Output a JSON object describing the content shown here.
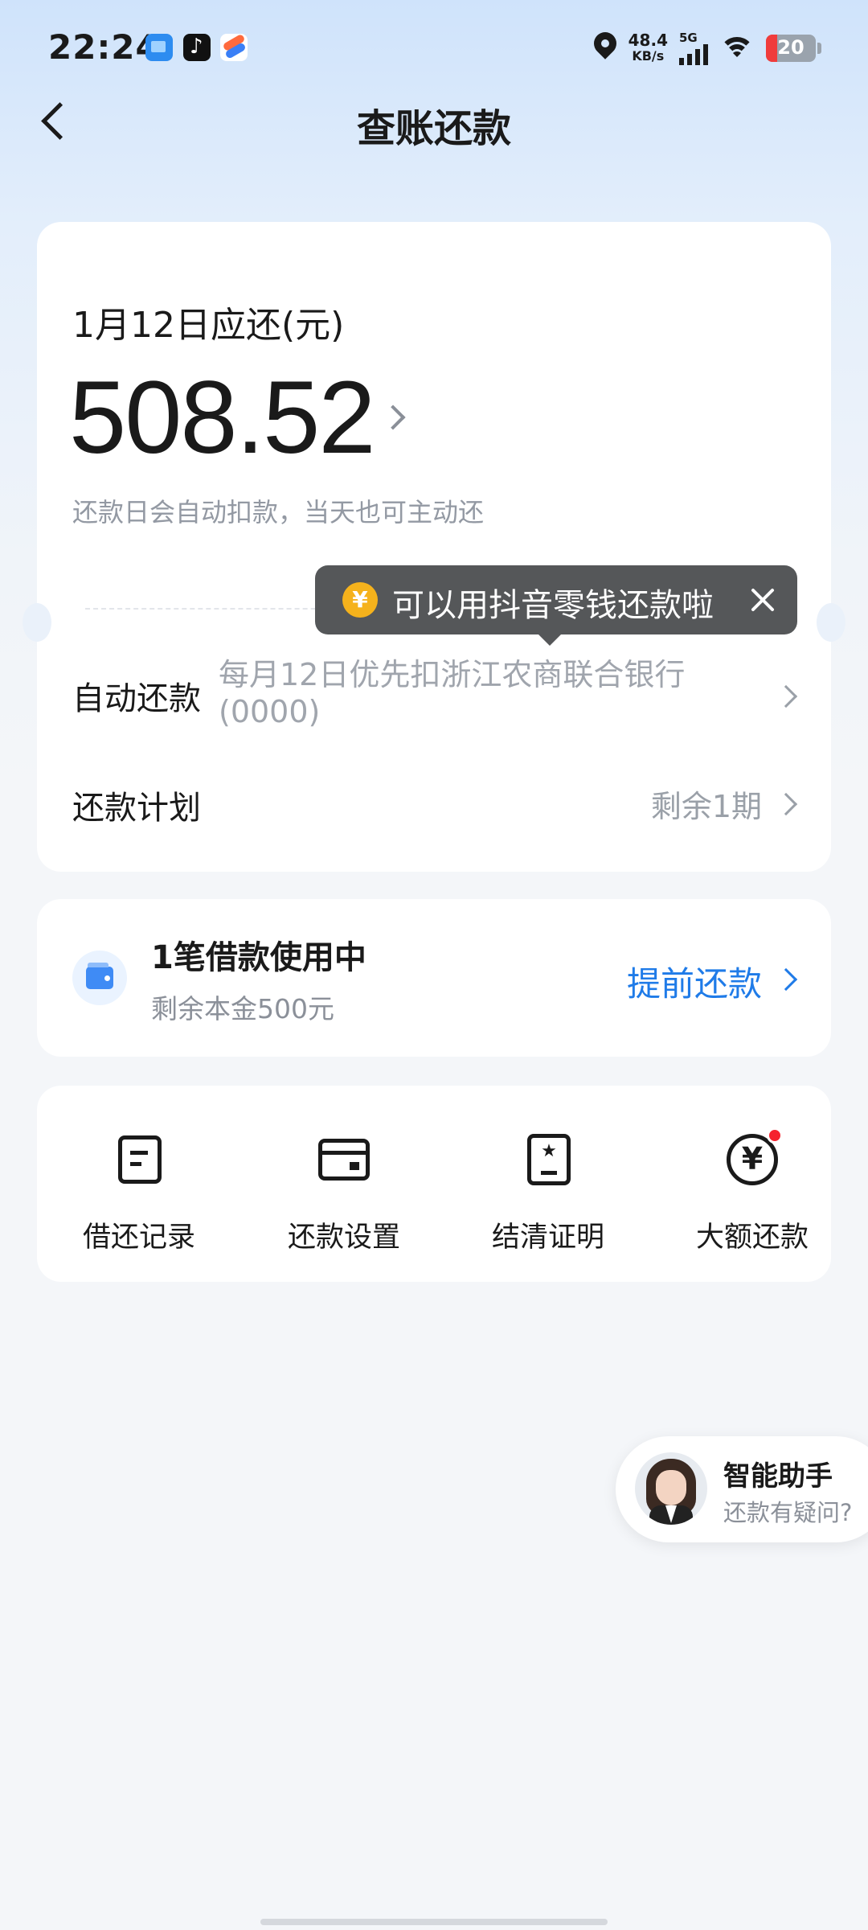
{
  "status_bar": {
    "time": "22:24",
    "net_speed_value": "48.4",
    "net_speed_unit": "KB/s",
    "network_type": "5G",
    "battery_level": "20"
  },
  "header": {
    "title": "查账还款"
  },
  "bill": {
    "due_label": "1月12日应还(元)",
    "amount": "508.52",
    "auto_deduct_note": "还款日会自动扣款，当天也可主动还"
  },
  "tooltip": {
    "icon": "¥",
    "text": "可以用抖音零钱还款啦"
  },
  "auto_repay": {
    "label": "自动还款",
    "value": "每月12日优先扣浙江农商联合银行(0000)"
  },
  "repay_plan": {
    "label": "还款计划",
    "value": "剩余1期"
  },
  "loan": {
    "title": "1笔借款使用中",
    "remaining": "剩余本金500元",
    "action": "提前还款"
  },
  "actions": [
    {
      "label": "借还记录",
      "icon": "record-icon"
    },
    {
      "label": "还款设置",
      "icon": "card-icon"
    },
    {
      "label": "结清证明",
      "icon": "certificate-icon"
    },
    {
      "label": "大额还款",
      "icon": "yen-circle-icon",
      "badge": true
    }
  ],
  "assistant": {
    "title": "智能助手",
    "subtitle": "还款有疑问?"
  },
  "colors": {
    "accent": "#1f7be8",
    "badge": "#f5222d",
    "tooltip_bg": "#555759",
    "coin": "#f5b21c"
  }
}
